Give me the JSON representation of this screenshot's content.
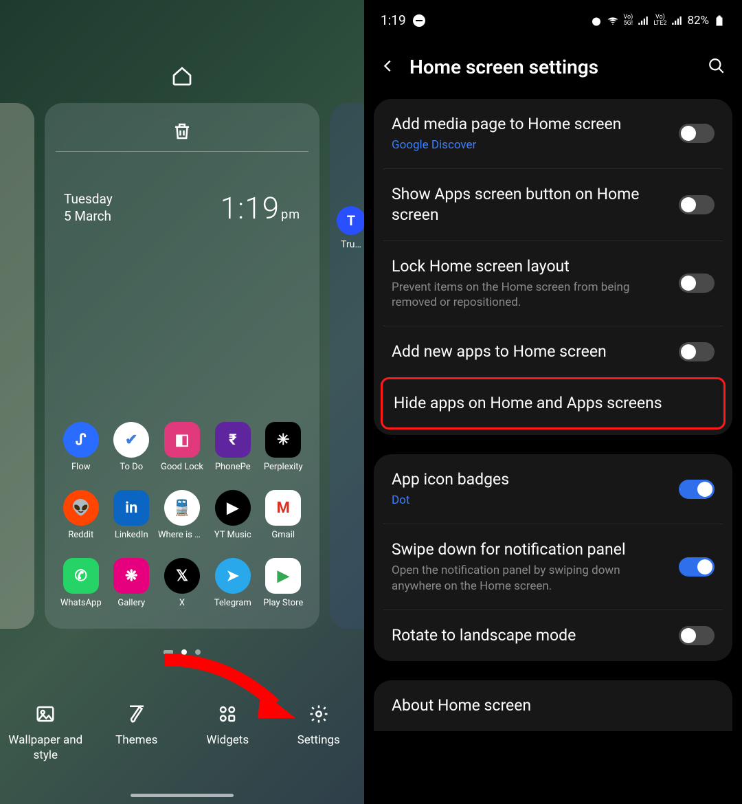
{
  "status": {
    "time": "1:19",
    "battery": "82%"
  },
  "left": {
    "date_day": "Tuesday",
    "date_line": "5 March",
    "clock": "1:19",
    "clock_suffix": "pm",
    "side_app": "Tru…",
    "apps": [
      {
        "label": "Flow",
        "bg": "#2a6cff",
        "round": true,
        "txt": "ᔑ"
      },
      {
        "label": "To Do",
        "bg": "#ffffff",
        "round": true,
        "txt": "✔",
        "fg": "#3a7ce0"
      },
      {
        "label": "Good Lock",
        "bg": "#e03a7c",
        "round": false,
        "txt": "◧"
      },
      {
        "label": "PhonePe",
        "bg": "#5f259f",
        "round": false,
        "txt": "₹"
      },
      {
        "label": "Perplexity",
        "bg": "#000000",
        "round": false,
        "txt": "✳"
      },
      {
        "label": "Reddit",
        "bg": "#ff4500",
        "round": true,
        "txt": "👽"
      },
      {
        "label": "LinkedIn",
        "bg": "#0a66c2",
        "round": false,
        "txt": "in"
      },
      {
        "label": "Where is my…",
        "bg": "#ffffff",
        "round": true,
        "txt": "🚆",
        "fg": "#000"
      },
      {
        "label": "YT Music",
        "bg": "#000000",
        "round": true,
        "txt": "▶"
      },
      {
        "label": "Gmail",
        "bg": "#ffffff",
        "round": false,
        "txt": "M",
        "fg": "#d93025"
      },
      {
        "label": "WhatsApp",
        "bg": "#25d366",
        "round": false,
        "txt": "✆"
      },
      {
        "label": "Gallery",
        "bg": "#e6007e",
        "round": false,
        "txt": "❋"
      },
      {
        "label": "X",
        "bg": "#000000",
        "round": true,
        "txt": "𝕏"
      },
      {
        "label": "Telegram",
        "bg": "#29a9eb",
        "round": true,
        "txt": "➤"
      },
      {
        "label": "Play Store",
        "bg": "#ffffff",
        "round": false,
        "txt": "▶",
        "fg": "#34a853"
      }
    ],
    "actions": [
      {
        "label": "Wallpaper and\nstyle",
        "icon": "image"
      },
      {
        "label": "Themes",
        "icon": "brush"
      },
      {
        "label": "Widgets",
        "icon": "widgets"
      },
      {
        "label": "Settings",
        "icon": "gear"
      }
    ]
  },
  "right": {
    "title": "Home screen settings",
    "group1": [
      {
        "title": "Add media page to Home screen",
        "sub": "Google Discover",
        "sublink": true,
        "toggle": false
      },
      {
        "title": "Show Apps screen button on Home screen",
        "toggle": false
      },
      {
        "title": "Lock Home screen layout",
        "sub": "Prevent items on the Home screen from being removed or repositioned.",
        "toggle": false
      },
      {
        "title": "Add new apps to Home screen",
        "toggle": false
      },
      {
        "title": "Hide apps on Home and Apps screens",
        "highlight": true
      }
    ],
    "group2": [
      {
        "title": "App icon badges",
        "sub": "Dot",
        "sublink": true,
        "toggle": true
      },
      {
        "title": "Swipe down for notification panel",
        "sub": "Open the notification panel by swiping down anywhere on the Home screen.",
        "toggle": true
      },
      {
        "title": "Rotate to landscape mode",
        "toggle": false
      }
    ],
    "group3": [
      {
        "title": "About Home screen"
      }
    ]
  }
}
